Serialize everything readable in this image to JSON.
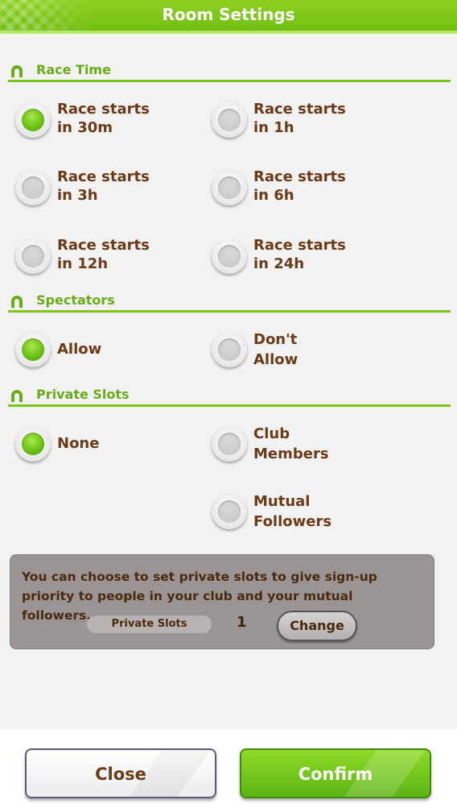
{
  "header": {
    "title": "Room Settings"
  },
  "sections": {
    "race_time": {
      "label": "Race Time",
      "options": [
        {
          "label": "Race starts\nin 30m",
          "selected": true
        },
        {
          "label": "Race starts\nin 1h",
          "selected": false
        },
        {
          "label": "Race starts\nin 3h",
          "selected": false
        },
        {
          "label": "Race starts\nin 6h",
          "selected": false
        },
        {
          "label": "Race starts\nin 12h",
          "selected": false
        },
        {
          "label": "Race starts\nin 24h",
          "selected": false
        }
      ]
    },
    "spectators": {
      "label": "Spectators",
      "options": [
        {
          "label": "Allow",
          "selected": true
        },
        {
          "label": "Don't\nAllow",
          "selected": false
        }
      ]
    },
    "private_slots": {
      "label": "Private Slots",
      "options": [
        {
          "label": "None",
          "selected": true
        },
        {
          "label": "Club\nMembers",
          "selected": false
        },
        {
          "label": "Mutual\nFollowers",
          "selected": false
        }
      ]
    }
  },
  "info": {
    "message": "You can choose to set private slots to give sign-up priority to people in your club and your mutual followers.",
    "slots_label": "Private Slots",
    "slots_value": "1",
    "change_label": "Change"
  },
  "footer": {
    "close_label": "Close",
    "confirm_label": "Confirm"
  },
  "colors": {
    "accent_green": "#7cc51d",
    "text_brown": "#6b3a16",
    "header_green": "#6fbd12"
  },
  "icons": {
    "section_icon": "horseshoe-icon"
  }
}
